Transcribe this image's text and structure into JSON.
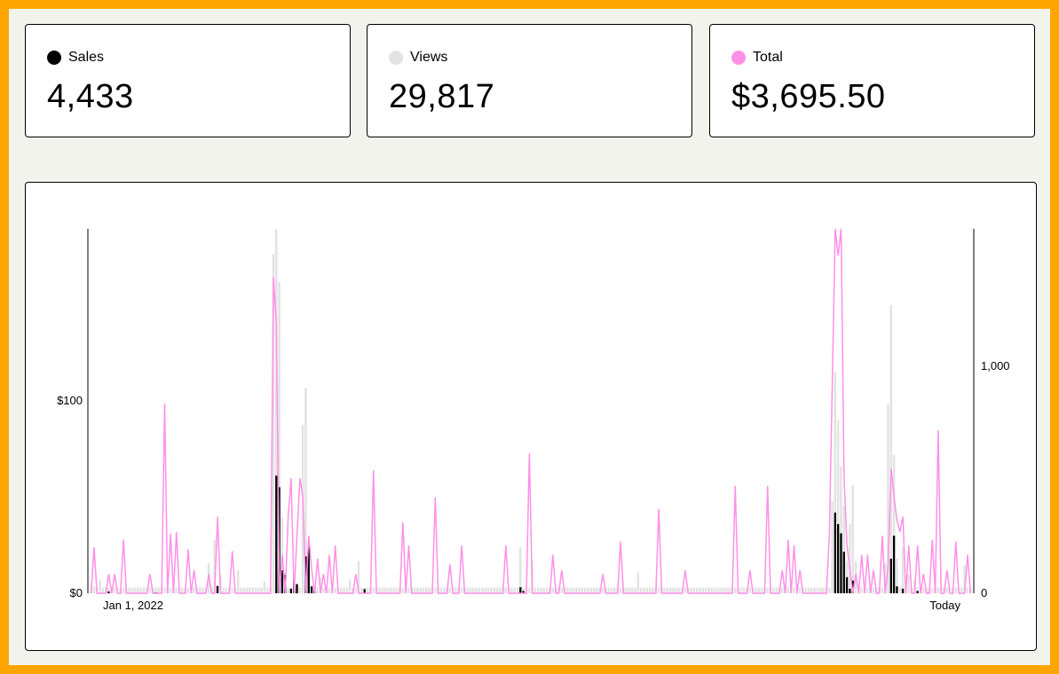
{
  "stats": [
    {
      "label": "Sales",
      "value": "4,433",
      "color": "#000000"
    },
    {
      "label": "Views",
      "value": "29,817",
      "color": "#e3e3e3"
    },
    {
      "label": "Total",
      "value": "$3,695.50",
      "color": "#ff90e8"
    }
  ],
  "chart_data": {
    "type": "bar",
    "x_start_label": "Jan 1, 2022",
    "x_end_label": "Today",
    "left_axis": {
      "ticks": [
        "$0",
        "$100"
      ],
      "ylim": [
        0,
        190
      ]
    },
    "right_axis": {
      "ticks": [
        "0",
        "1,000"
      ],
      "ylim": [
        0,
        1580
      ]
    },
    "series": [
      {
        "name": "Sales",
        "kind": "bar",
        "axis": "right",
        "color": "#000000",
        "spikes": [
          [
            6,
            8
          ],
          [
            22,
            4
          ],
          [
            43,
            32
          ],
          [
            63,
            510
          ],
          [
            64,
            460
          ],
          [
            65,
            100
          ],
          [
            66,
            80
          ],
          [
            68,
            20
          ],
          [
            69,
            60
          ],
          [
            70,
            40
          ],
          [
            73,
            160
          ],
          [
            74,
            220
          ],
          [
            75,
            30
          ],
          [
            76,
            20
          ],
          [
            93,
            18
          ],
          [
            146,
            26
          ],
          [
            147,
            10
          ],
          [
            253,
            350
          ],
          [
            254,
            300
          ],
          [
            255,
            260
          ],
          [
            256,
            180
          ],
          [
            257,
            70
          ],
          [
            258,
            20
          ],
          [
            259,
            55
          ],
          [
            272,
            150
          ],
          [
            273,
            250
          ],
          [
            274,
            30
          ],
          [
            276,
            20
          ],
          [
            281,
            10
          ]
        ]
      },
      {
        "name": "Views",
        "kind": "bar",
        "axis": "right",
        "color": "#e3e3e3",
        "spikes": [
          [
            1,
            30
          ],
          [
            3,
            60
          ],
          [
            40,
            130
          ],
          [
            42,
            230
          ],
          [
            44,
            80
          ],
          [
            50,
            100
          ],
          [
            59,
            50
          ],
          [
            62,
            1470
          ],
          [
            63,
            1580
          ],
          [
            64,
            1350
          ],
          [
            65,
            330
          ],
          [
            72,
            730
          ],
          [
            73,
            890
          ],
          [
            78,
            70
          ],
          [
            88,
            60
          ],
          [
            91,
            140
          ],
          [
            146,
            200
          ],
          [
            150,
            140
          ],
          [
            186,
            90
          ],
          [
            252,
            400
          ],
          [
            253,
            960
          ],
          [
            254,
            750
          ],
          [
            255,
            550
          ],
          [
            256,
            380
          ],
          [
            257,
            140
          ],
          [
            258,
            300
          ],
          [
            259,
            470
          ],
          [
            260,
            140
          ],
          [
            270,
            130
          ],
          [
            271,
            820
          ],
          [
            272,
            1250
          ],
          [
            273,
            600
          ],
          [
            274,
            150
          ],
          [
            276,
            200
          ],
          [
            278,
            80
          ],
          [
            280,
            60
          ],
          [
            297,
            120
          ]
        ],
        "base": 25
      },
      {
        "name": "Total",
        "kind": "line",
        "axis": "left",
        "color": "#ff90e8",
        "spikes": [
          [
            1,
            24
          ],
          [
            6,
            10
          ],
          [
            8,
            10
          ],
          [
            11,
            28
          ],
          [
            20,
            10
          ],
          [
            25,
            99
          ],
          [
            27,
            31
          ],
          [
            29,
            32
          ],
          [
            33,
            23
          ],
          [
            35,
            12
          ],
          [
            40,
            10
          ],
          [
            43,
            40
          ],
          [
            48,
            22
          ],
          [
            62,
            165
          ],
          [
            63,
            140
          ],
          [
            65,
            20
          ],
          [
            67,
            40
          ],
          [
            68,
            60
          ],
          [
            70,
            30
          ],
          [
            71,
            60
          ],
          [
            72,
            50
          ],
          [
            74,
            30
          ],
          [
            75,
            12
          ],
          [
            77,
            18
          ],
          [
            79,
            10
          ],
          [
            81,
            20
          ],
          [
            83,
            25
          ],
          [
            90,
            10
          ],
          [
            96,
            64
          ],
          [
            106,
            37
          ],
          [
            108,
            25
          ],
          [
            117,
            50
          ],
          [
            122,
            15
          ],
          [
            126,
            25
          ],
          [
            141,
            25
          ],
          [
            149,
            73
          ],
          [
            157,
            20
          ],
          [
            160,
            12
          ],
          [
            174,
            10
          ],
          [
            180,
            27
          ],
          [
            193,
            44
          ],
          [
            202,
            12
          ],
          [
            219,
            56
          ],
          [
            224,
            12
          ],
          [
            230,
            56
          ],
          [
            235,
            12
          ],
          [
            237,
            28
          ],
          [
            239,
            25
          ],
          [
            241,
            12
          ],
          [
            251,
            30
          ],
          [
            252,
            110
          ],
          [
            253,
            190
          ],
          [
            254,
            176
          ],
          [
            255,
            190
          ],
          [
            256,
            60
          ],
          [
            257,
            25
          ],
          [
            258,
            12
          ],
          [
            260,
            10
          ],
          [
            262,
            20
          ],
          [
            264,
            20
          ],
          [
            266,
            12
          ],
          [
            269,
            30
          ],
          [
            271,
            15
          ],
          [
            272,
            65
          ],
          [
            273,
            50
          ],
          [
            274,
            38
          ],
          [
            275,
            32
          ],
          [
            276,
            40
          ],
          [
            278,
            25
          ],
          [
            281,
            25
          ],
          [
            283,
            10
          ],
          [
            286,
            28
          ],
          [
            288,
            85
          ],
          [
            291,
            12
          ],
          [
            294,
            27
          ],
          [
            298,
            20
          ]
        ]
      }
    ]
  }
}
